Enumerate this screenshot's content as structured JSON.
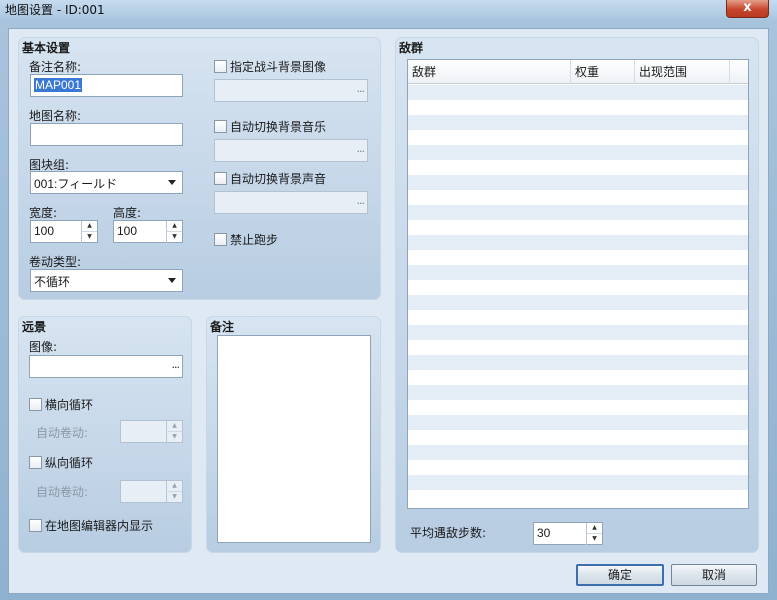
{
  "window": {
    "title": "地图设置 - ID:001",
    "close": "x"
  },
  "basic": {
    "title": "基本设置",
    "display_name_label": "备注名称:",
    "display_name_value": "MAP001",
    "map_name_label": "地图名称:",
    "map_name_value": "",
    "tileset_label": "图块组:",
    "tileset_value": "001:フィールド",
    "width_label": "宽度:",
    "width_value": "100",
    "height_label": "高度:",
    "height_value": "100",
    "scroll_label": "卷动类型:",
    "scroll_value": "不循环",
    "battleback_label": "指定战斗背景图像",
    "bgm_label": "自动切换背景音乐",
    "bgs_label": "自动切换背景声音",
    "disable_dash_label": "禁止跑步"
  },
  "parallax": {
    "title": "远景",
    "image_label": "图像:",
    "loop_h_label": "横向循环",
    "auto_scroll_label_1": "自动卷动:",
    "loop_v_label": "纵向循环",
    "auto_scroll_label_2": "自动卷动:",
    "show_in_editor_label": "在地图编辑器内显示"
  },
  "note": {
    "title": "备注"
  },
  "encounters": {
    "title": "敌群",
    "columns": [
      "敌群",
      "权重",
      "出现范围"
    ],
    "steps_label": "平均遇敌步数:",
    "steps_value": "30"
  },
  "buttons": {
    "ok": "确定",
    "cancel": "取消"
  },
  "icons": {
    "ellipsis": "...",
    "spin_up": "▲",
    "spin_down": "▼"
  }
}
